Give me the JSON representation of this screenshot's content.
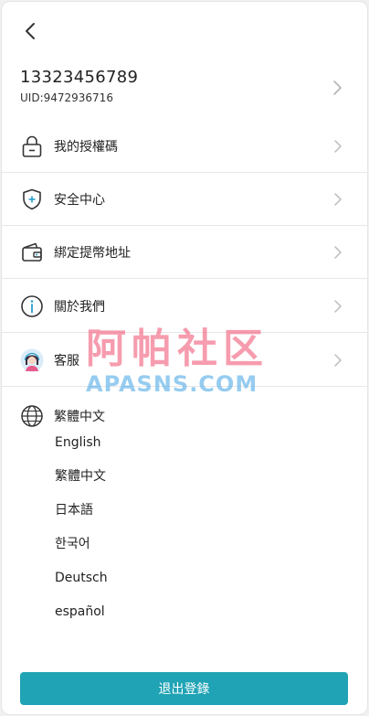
{
  "header": {
    "back_icon": "chevron-left-icon"
  },
  "profile": {
    "phone": "13323456789",
    "uid": "UID:9472936716"
  },
  "menu": [
    {
      "id": "auth-code",
      "label": "我的授權碼",
      "icon": "lock-icon"
    },
    {
      "id": "security-center",
      "label": "安全中心",
      "icon": "shield-plus-icon"
    },
    {
      "id": "withdraw-address",
      "label": "綁定提幣地址",
      "icon": "wallet-icon"
    },
    {
      "id": "about-us",
      "label": "關於我們",
      "icon": "info-icon"
    },
    {
      "id": "customer-service",
      "label": "客服",
      "icon": "support-avatar-icon"
    }
  ],
  "language": {
    "current": "繁體中文",
    "icon": "globe-icon",
    "options": [
      "English",
      "繁體中文",
      "日本語",
      "한국어",
      "Deutsch",
      "español"
    ]
  },
  "logout_label": "退出登錄",
  "watermark": {
    "cn": "阿帕社区",
    "en": "APASNS.COM"
  },
  "colors": {
    "accent": "#1fa3b5",
    "info_icon": "#2a9fc9",
    "divider": "#e8e8e8"
  }
}
